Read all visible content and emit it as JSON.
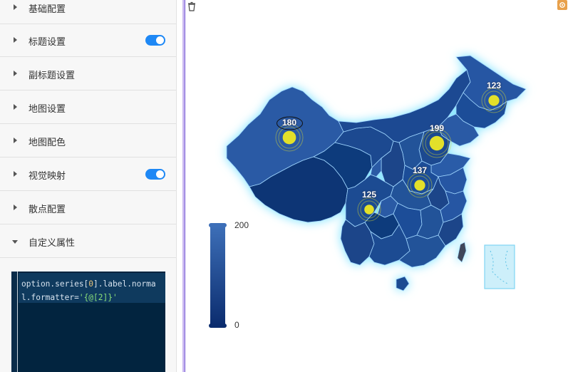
{
  "settings": {
    "sections": [
      {
        "label": "基础配置",
        "expanded": false,
        "toggle": null
      },
      {
        "label": "标题设置",
        "expanded": false,
        "toggle": true
      },
      {
        "label": "副标题设置",
        "expanded": false,
        "toggle": null
      },
      {
        "label": "地图设置",
        "expanded": false,
        "toggle": null
      },
      {
        "label": "地图配色",
        "expanded": false,
        "toggle": null
      },
      {
        "label": "视觉映射",
        "expanded": false,
        "toggle": true
      },
      {
        "label": "散点配置",
        "expanded": false,
        "toggle": null
      },
      {
        "label": "自定义属性",
        "expanded": true,
        "toggle": null
      }
    ],
    "code": {
      "prefix": "option.series[",
      "index": "0",
      "middle": "].label.normal.formatter=",
      "string": "'{@[2]}'"
    }
  },
  "map": {
    "visual_map": {
      "max": "200",
      "min": "0",
      "color_top": "#3d6fb8",
      "color_bottom": "#0b2c6e"
    },
    "scatter": [
      {
        "value": "180"
      },
      {
        "value": "199"
      },
      {
        "value": "123"
      },
      {
        "value": "137"
      },
      {
        "value": "125"
      }
    ],
    "marker_color": "#e3e02a",
    "fill_color": "#1f4c92",
    "glow_color": "#7fe4ff"
  }
}
